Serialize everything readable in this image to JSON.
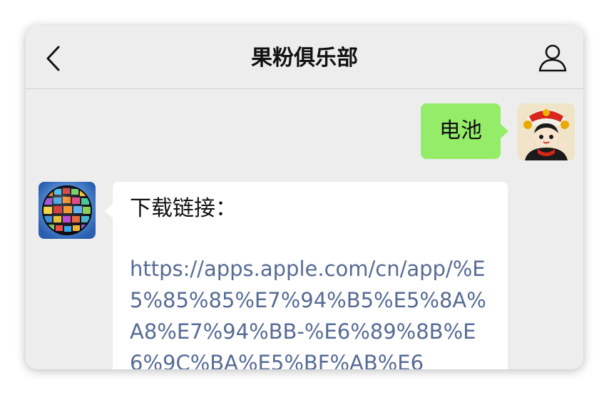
{
  "header": {
    "title": "果粉俱乐部",
    "back_icon": "chevron-left-icon",
    "profile_icon": "person-icon"
  },
  "messages": [
    {
      "sender": "me",
      "text": "电池",
      "bubble_color": "#95ec69"
    },
    {
      "sender": "bot",
      "label": "下载链接：",
      "link": "https://apps.apple.com/cn/app/%E5%85%85%E7%94%B5%E5%8A%A8%E7%94%BB-%E6%89%8B%E6%9C%BA%E5%BF%AB%E6",
      "bubble_color": "#ffffff",
      "link_color": "#576b95"
    }
  ],
  "colors": {
    "background": "#ededed",
    "accent_green": "#95ec69"
  }
}
